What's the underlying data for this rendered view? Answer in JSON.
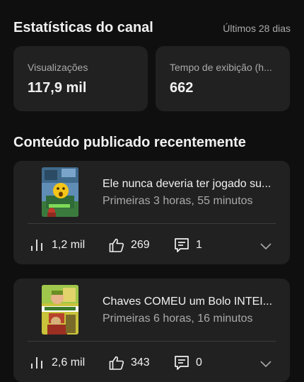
{
  "channel_stats": {
    "title": "Estatísticas do canal",
    "range": "Últimos 28 dias",
    "views": {
      "label": "Visualizações",
      "value": "117,9 mil"
    },
    "watch_time": {
      "label": "Tempo de exibição (h...",
      "value": "662"
    }
  },
  "recent": {
    "title": "Conteúdo publicado recentemente",
    "videos": [
      {
        "title": "Ele nunca deveria ter jogado su...",
        "meta": "Primeiras 3 horas, 55 minutos",
        "views": "1,2 mil",
        "likes": "269",
        "comments": "1"
      },
      {
        "title": "Chaves COMEU um Bolo INTEI...",
        "meta": "Primeiras 6 horas, 16 minutos",
        "views": "2,6 mil",
        "likes": "343",
        "comments": "0"
      }
    ]
  },
  "icons": {
    "views": "bar-chart-icon",
    "likes": "thumbs-up-icon",
    "comments": "comment-icon",
    "expand": "chevron-down-icon"
  },
  "colors": {
    "background": "#0f0f0f",
    "card": "#212121",
    "text_primary": "#f1f1f1",
    "text_secondary": "#aaaaaa"
  }
}
